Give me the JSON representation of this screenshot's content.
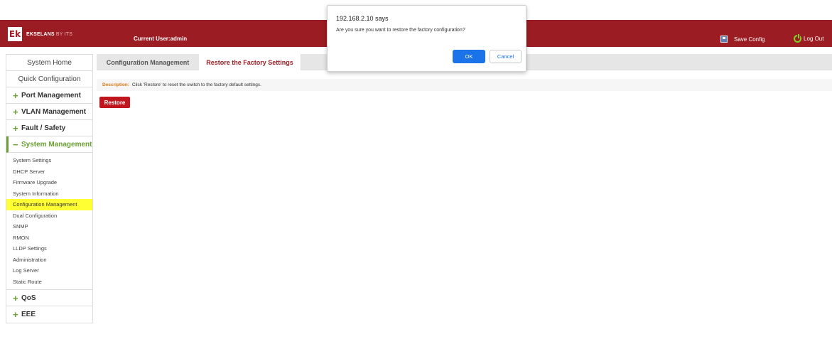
{
  "header": {
    "logo_mark": "Ek",
    "logo_brand": "EKSELANS",
    "logo_suffix": "BY ITS",
    "current_user": "Current User:admin",
    "save_config": "Save Config",
    "log_out": "Log Out",
    "background_color": "#9b1c22"
  },
  "sidebar": {
    "system_home": "System Home",
    "quick_config": "Quick Configuration",
    "groups": {
      "port": "Port Management",
      "vlan": "VLAN Management",
      "fault": "Fault / Safety",
      "system": "System Management",
      "qos": "QoS",
      "eee": "EEE"
    },
    "plus_symbol": "+",
    "minus_symbol": "−",
    "system_items": [
      "System Settings",
      "DHCP Server",
      "Firmware Upgrade",
      "System Information",
      "Configuration Management",
      "Dual Configuration",
      "SNMP",
      "RMON",
      "LLDP Settings",
      "Administration",
      "Log Server",
      "Static Route"
    ],
    "active_item": "Configuration Management"
  },
  "tabs": [
    {
      "label": "Configuration Management",
      "active": false
    },
    {
      "label": "Restore the Factory Settings",
      "active": true
    }
  ],
  "content": {
    "description_label": "Description:",
    "description_text": "Click 'Restore' to reset the switch to the factory default settings.",
    "restore_button": "Restore"
  },
  "dialog": {
    "title": "192.168.2.10 says",
    "message": "Are you sure you want to restore the factory configuration?",
    "ok_label": "OK",
    "cancel_label": "Cancel"
  }
}
